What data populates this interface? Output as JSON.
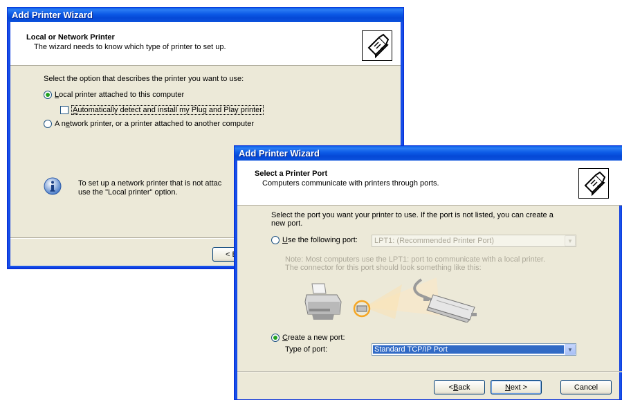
{
  "window1": {
    "title": "Add Printer Wizard",
    "header_title": "Local or Network Printer",
    "header_subtitle": "The wizard needs to know which type of printer to set up.",
    "prompt": "Select the option that describes the printer you want to use:",
    "option_local": {
      "prefix": "",
      "accel": "L",
      "rest": "ocal printer attached to this computer",
      "checked": true
    },
    "option_autodetect": {
      "prefix": "",
      "accel": "A",
      "rest": "utomatically detect and install my Plug and Play printer",
      "checked": false
    },
    "option_network": {
      "prefix": "A n",
      "accel": "e",
      "rest": "twork printer, or a printer attached to another computer",
      "checked": false
    },
    "info_line1": "To set up a network printer that is not attac",
    "info_line2": "use the \"Local printer\" option.",
    "back_button_partial": "< B"
  },
  "window2": {
    "title": "Add Printer Wizard",
    "header_title": "Select a Printer Port",
    "header_subtitle": "Computers communicate with printers through ports.",
    "prompt_line1": "Select the port you want your printer to use.  If the port is not listed, you can create a",
    "prompt_line2": "new port.",
    "option_existing": {
      "prefix": "",
      "accel": "U",
      "rest": "se the following port:",
      "checked": false
    },
    "existing_port_value": "LPT1: (Recommended Printer Port)",
    "note_line1": "Note: Most computers use the LPT1: port to communicate with a local printer.",
    "note_line2": "The connector for this port should look something like this:",
    "option_new": {
      "prefix": "",
      "accel": "C",
      "rest": "reate a new port:",
      "checked": true
    },
    "type_of_port_label": "Type of port:",
    "type_of_port_value": "Standard TCP/IP Port",
    "back_button": {
      "prefix": "< ",
      "accel": "B",
      "rest": "ack"
    },
    "next_button": {
      "prefix": "",
      "accel": "N",
      "rest": "ext >"
    },
    "cancel_button": "Cancel"
  },
  "colors": {
    "titlebar_blue": "#0a5eea",
    "dialog_face": "#ece9d8",
    "selection_blue": "#316ac5",
    "radio_green": "#21a121",
    "port_highlight": "#f5a623"
  },
  "icons": [
    "printer-wizard-icon",
    "info-icon",
    "printer-illustration",
    "parallel-cable-illustration",
    "dropdown-arrow-icon"
  ]
}
